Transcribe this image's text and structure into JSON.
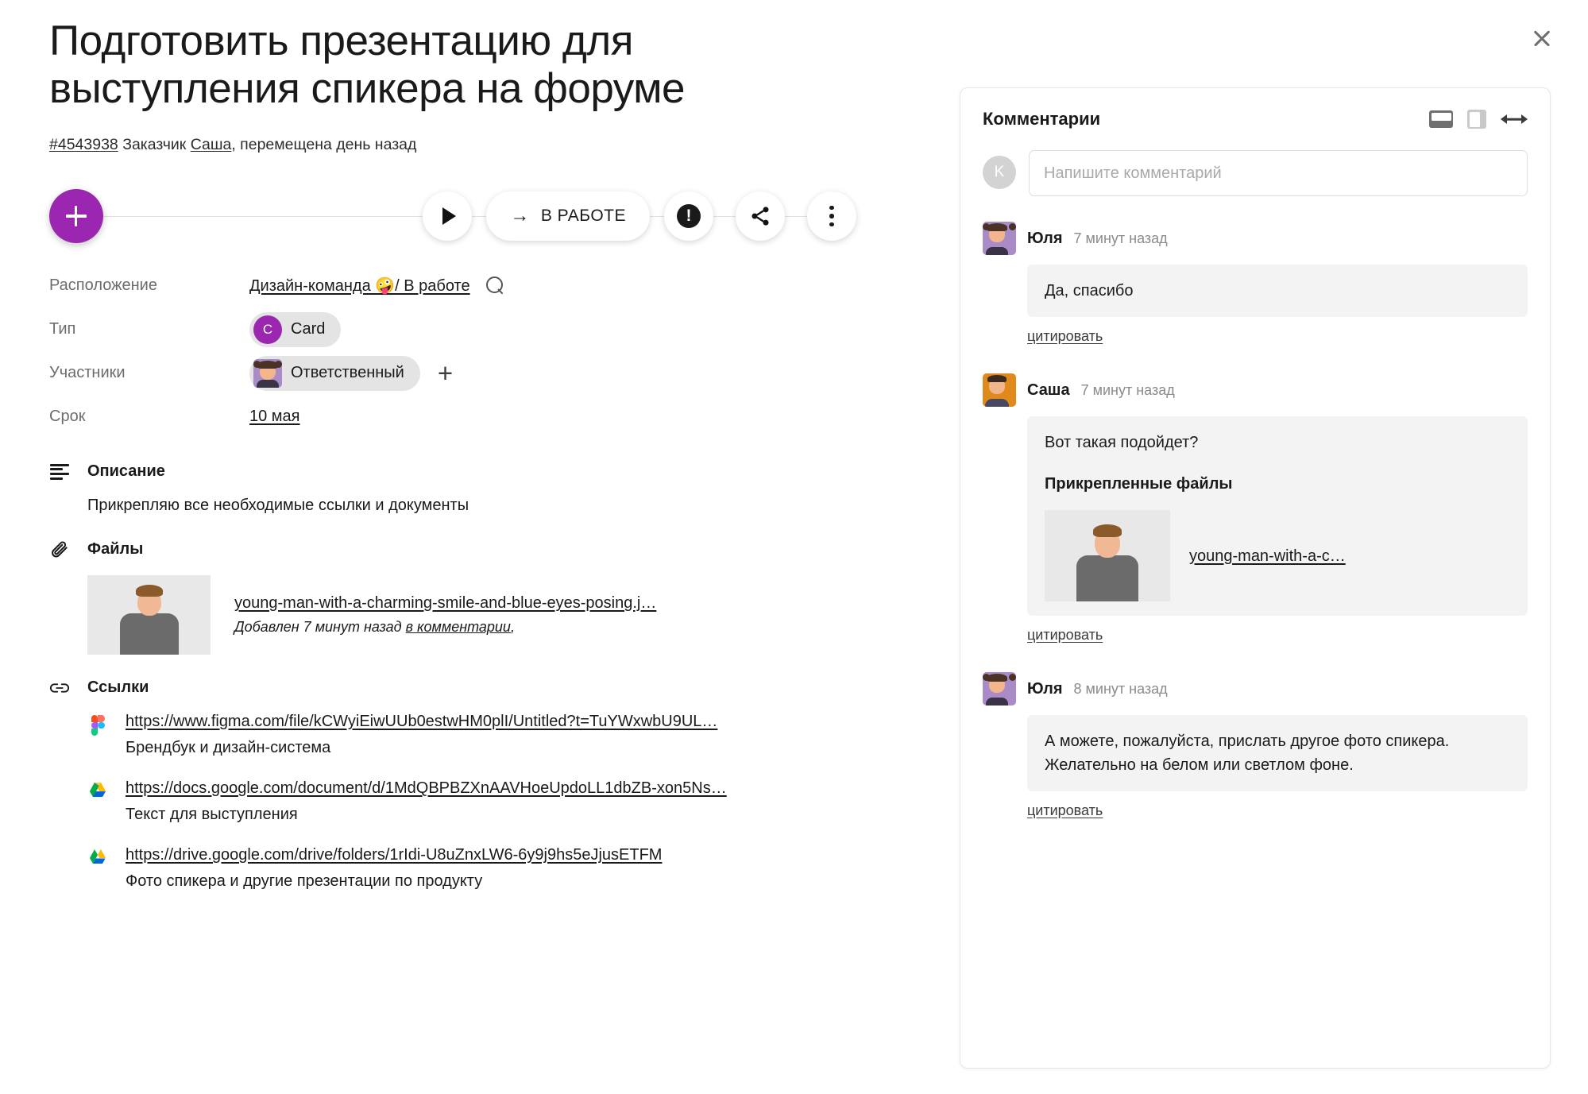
{
  "task": {
    "title": "Подготовить презентацию для выступления спикера на форуме",
    "id": "#4543938",
    "customer_label": "Заказчик",
    "customer_name": "Саша",
    "moved_text": ", перемещена день назад"
  },
  "toolbar": {
    "add_label": "+",
    "play_label": "play-icon",
    "status_label": "В РАБОТЕ",
    "status_arrow": "→",
    "alert_label": "!",
    "share_label": "share-icon",
    "more_label": "more-icon"
  },
  "properties": [
    {
      "label": "Расположение",
      "value": "Дизайн-команда 🤪/ В работе",
      "type": "link-with-search"
    },
    {
      "label": "Тип",
      "value": "Card",
      "avatar_letter": "C",
      "type": "chip"
    },
    {
      "label": "Участники",
      "value": "Ответственный",
      "type": "chip-avatar"
    },
    {
      "label": "Срок",
      "value": "10 мая",
      "type": "link"
    }
  ],
  "description": {
    "heading": "Описание",
    "text": "Прикрепляю все необходимые ссылки и документы"
  },
  "files": {
    "heading": "Файлы",
    "items": [
      {
        "name": "young-man-with-a-charming-smile-and-blue-eyes-posing.j…",
        "meta_prefix": "Добавлен 7 минут назад ",
        "meta_link": "в комментарии",
        "meta_suffix": ","
      }
    ]
  },
  "links": {
    "heading": "Ссылки",
    "items": [
      {
        "icon": "figma-icon",
        "url": "https://www.figma.com/file/kCWyiEiwUUb0estwHM0plI/Untitled?t=TuYWxwbU9UL…",
        "description": "Брендбук и дизайн-система"
      },
      {
        "icon": "google-drive-icon",
        "url": "https://docs.google.com/document/d/1MdQBPBZXnAAVHoeUpdoLL1dbZB-xon5Ns…",
        "description": "Текст для выступления"
      },
      {
        "icon": "google-drive-icon",
        "url": "https://drive.google.com/drive/folders/1rIdi-U8uZnxLW6-6y9j9hs5eJjusETFM",
        "description": "Фото спикера и другие презентации по продукту"
      }
    ]
  },
  "comments_panel": {
    "title": "Комментарии",
    "composer": {
      "avatar_letter": "K",
      "placeholder": "Напишите комментарий",
      "value": ""
    },
    "quote_label": "цитировать",
    "comments": [
      {
        "author": "Юля",
        "avatar": "girl",
        "time": "7 минут назад",
        "text": "Да, спасибо",
        "quote": "цитировать"
      },
      {
        "author": "Саша",
        "avatar": "man",
        "time": "7 минут назад",
        "text": "Вот такая подойдет?",
        "attachment_heading": "Прикрепленные файлы",
        "attachment_name": "young-man-with-a-c…",
        "quote": "цитировать"
      },
      {
        "author": "Юля",
        "avatar": "girl",
        "time": "8 минут назад",
        "text": "А можете, пожалуйста, прислать другое фото спикера. Желательно на белом или светлом фоне.",
        "quote": "цитировать"
      }
    ]
  },
  "colors": {
    "accent": "#9B27B0",
    "bubble": "#f3f3f3",
    "muted_text": "#8a8a8a"
  },
  "close_label": "×"
}
